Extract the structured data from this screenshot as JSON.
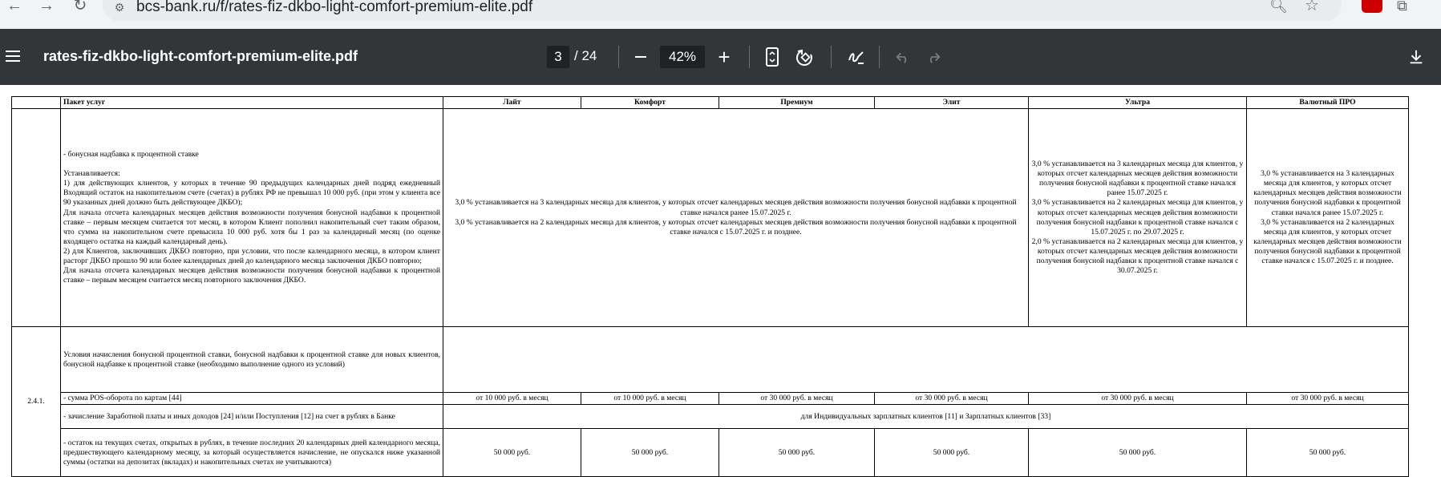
{
  "browser": {
    "url": "bcs-bank.ru/f/rates-fiz-dkbo-light-comfort-premium-elite.pdf"
  },
  "viewer": {
    "title": "rates-fiz-dkbo-light-comfort-premium-elite.pdf",
    "page_current": "3",
    "page_total": "/ 24",
    "zoom": "42%"
  },
  "table": {
    "headers": [
      "",
      "Пакет услуг",
      "Лайт",
      "Комфорт",
      "Премиум",
      "Элит",
      "Ультра",
      "Валютный ПРО"
    ],
    "bonus_row": {
      "number": "",
      "description": "- бонусная надбавка к процентной ставке\n\nУстанавливается:\n1) для действующих клиентов, у которых в течение 90 предыдущих календарных дней подряд ежедневный Входящий остаток на накопительном счете (счетах) в рублях РФ не превышал 10 000 руб. (при этом у клиента все 90 указанных дней должно быть действующее ДКБО);\nДля начала отсчета календарных месяцев действия возможности получения бонусной надбавки к процентной ставке – первым месяцем считается тот месяц, в котором Клиент пополнил накопительный счет таким образом, что сумма на накопительном счете превысила 10 000 руб. хотя бы 1 раз за календарный месяц (по оценке входящего остатка на каждый календарный день).\n2) для Клиентов, заключивших ДКБО повторно, при условии, что после календарного месяца, в котором клиент расторг ДКБО прошло 90 или более календарных дней до календарного месяца заключения ДКБО повторно;\nДля начала отсчета календарных месяцев действия возможности получения бонусной надбавки к процентной ставке – первым месяцем считается месяц повторного заключения ДКБО.",
      "packages_1_4": "3,0 % устанавливается на 3 календарных месяца для клиентов, у которых отсчет календарных месяцев действия возможности получения бонусной надбавки к процентной ставке начался ранее 15.07.2025 г.\n3,0 % устанавливается на 2 календарных месяца для клиентов, у которых отсчет календарных месяцев действия возможности получения бонусной надбавки к процентной ставке начался с 15.07.2025 г. и позднее.",
      "ultra": "3,0 % устанавливается на 3 календарных месяца для клиентов, у которых отсчет календарных месяцев действия возможности получения бонусной надбавки к процентной ставке начался ранее 15.07.2025 г.\n3,0 % устанавливается на 2 календарных месяца для клиентов, у которых отсчет календарных месяцев действия возможности получения бонусной надбавки к процентной ставке начался с 15.07.2025 г. по 29.07.2025 г.\n2,0 % устанавливается на 2 календарных месяца для клиентов, у которых отсчет календарных месяцев действия возможности получения бонусной надбавки к процентной ставке начался с 30.07.2025 г.",
      "currency_pro": "3,0 % устанавливается на 3 календарных месяца для клиентов, у которых отсчет календарных месяцев действия возможности получения бонусной надбавки к процентной ставки начался ранее 15.07.2025 г.\n3,0 % устанавливается на 2 календарных месяца для клиентов, у которых отсчет календарных месяцев действия возможности получения бонусной надбавки к процентной ставке начался с 15.07.2025 г. и позднее."
    },
    "section": {
      "number": "2.4.1.",
      "conditions_title": "Условия начисления бонусной процентной ставки, бонусной надбавки к процентной ставке для новых клиентов, бонусной надбавке к процентной ставке (необходимо выполнение одного из условий)",
      "pos_label": "- сумма POS-оборота по картам [44]",
      "pos_values": [
        "от 10 000 руб. в месяц",
        "от 10 000 руб. в месяц",
        "от 30 000 руб. в месяц",
        "от 30 000 руб. в месяц",
        "от 30 000 руб. в месяц",
        "от 30 000 руб. в месяц"
      ],
      "salary_label": "- зачисление Заработной платы и иных доходов [24] и/или Поступления [12] на счет в рублях в Банке",
      "salary_value": "для  Индивидуальных зарплатных клиентов [11] и Зарплатных клиентов [33]",
      "balance_label": "- остаток на текущих счетах, открытых в рублях, в течение последних 20 календарных дней календарного месяца, предшествующего календарному месяцу, за который осуществляется начисление, не опускался ниже указанной суммы  (остатки на депозитах (вкладах) и накопительных счетах не учитываются)",
      "balance_values": [
        "50 000 руб.",
        "50 000 руб.",
        "50 000 руб.",
        "50 000 руб.",
        "50 000 руб.",
        "50 000 руб."
      ]
    }
  }
}
